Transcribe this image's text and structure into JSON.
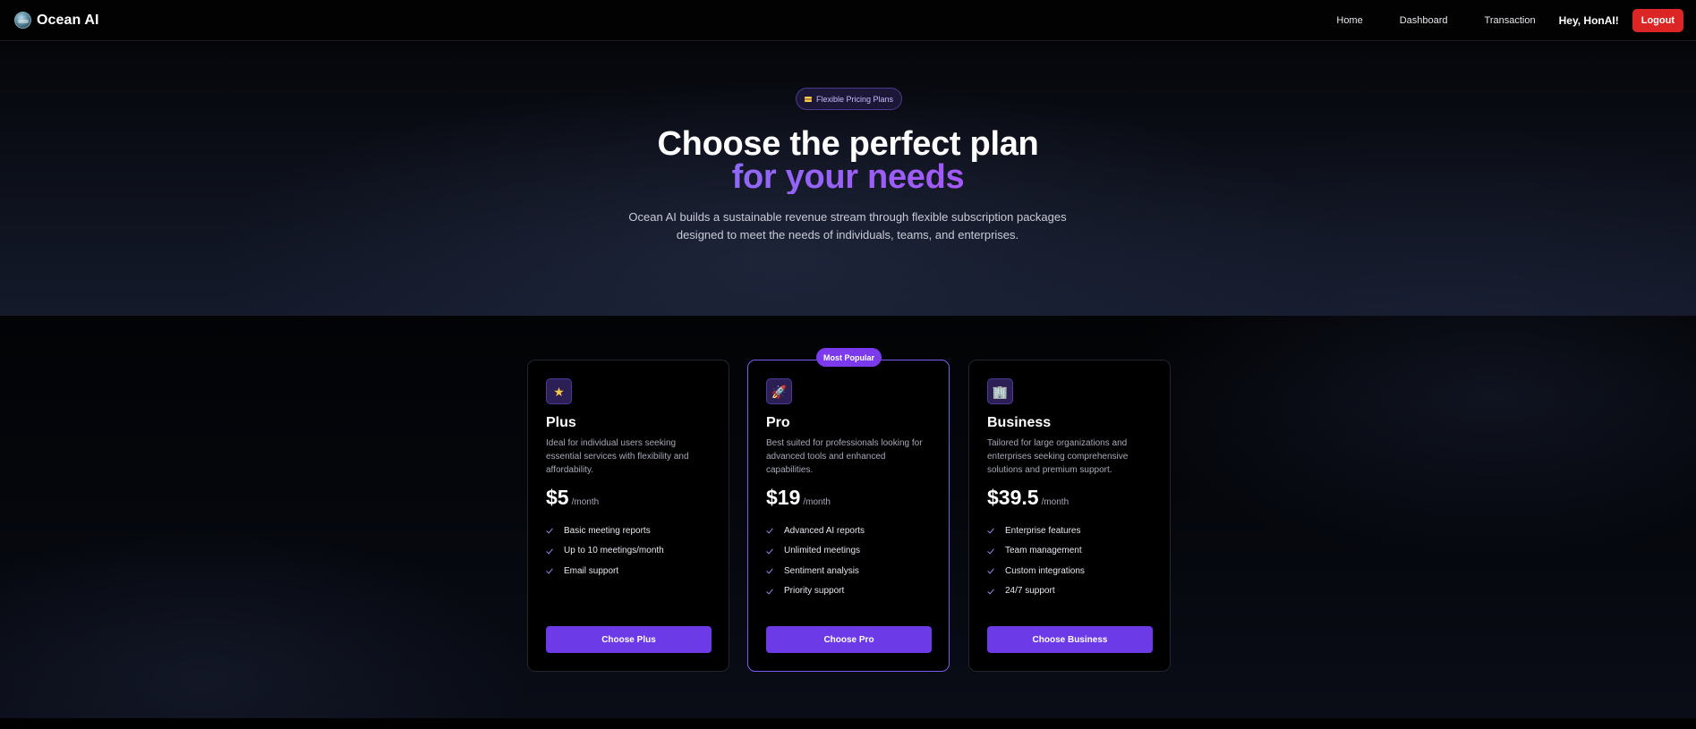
{
  "navbar": {
    "brand": "Ocean AI",
    "links": [
      {
        "label": "Home"
      },
      {
        "label": "Dashboard"
      },
      {
        "label": "Transaction"
      }
    ],
    "greeting": "Hey, HonAI!",
    "logout_label": "Logout"
  },
  "hero": {
    "badge_icon": "credit-card-icon",
    "badge": "Flexible Pricing Plans",
    "title": "Choose the perfect plan",
    "title_accent": "for your needs",
    "subtitle": "Ocean AI builds a sustainable revenue stream through flexible subscription packages designed to meet the needs of individuals, teams, and enterprises."
  },
  "pricing": {
    "popular_badge": "Most Popular",
    "plans": [
      {
        "icon": "star-icon",
        "icon_glyph": "★",
        "name": "Plus",
        "description": "Ideal for individual users seeking essential services with flexibility and affordability.",
        "price": "$5",
        "period": "/month",
        "features": [
          "Basic meeting reports",
          "Up to 10 meetings/month",
          "Email support"
        ],
        "button": "Choose Plus"
      },
      {
        "icon": "rocket-icon",
        "icon_glyph": "🚀",
        "name": "Pro",
        "description": "Best suited for professionals looking for advanced tools and enhanced capabilities.",
        "price": "$19",
        "period": "/month",
        "features": [
          "Advanced AI reports",
          "Unlimited meetings",
          "Sentiment analysis",
          "Priority support"
        ],
        "button": "Choose Pro"
      },
      {
        "icon": "office-building-icon",
        "icon_glyph": "🏢",
        "name": "Business",
        "description": "Tailored for large organizations and enterprises seeking comprehensive solutions and premium support.",
        "price": "$39.5",
        "period": "/month",
        "features": [
          "Enterprise features",
          "Team management",
          "Custom integrations",
          "24/7 support"
        ],
        "button": "Choose Business"
      }
    ]
  },
  "colors": {
    "accent": "#6d3ae8",
    "accent_light": "#8b6cf6",
    "logout": "#dc2626",
    "background": "#000000"
  }
}
